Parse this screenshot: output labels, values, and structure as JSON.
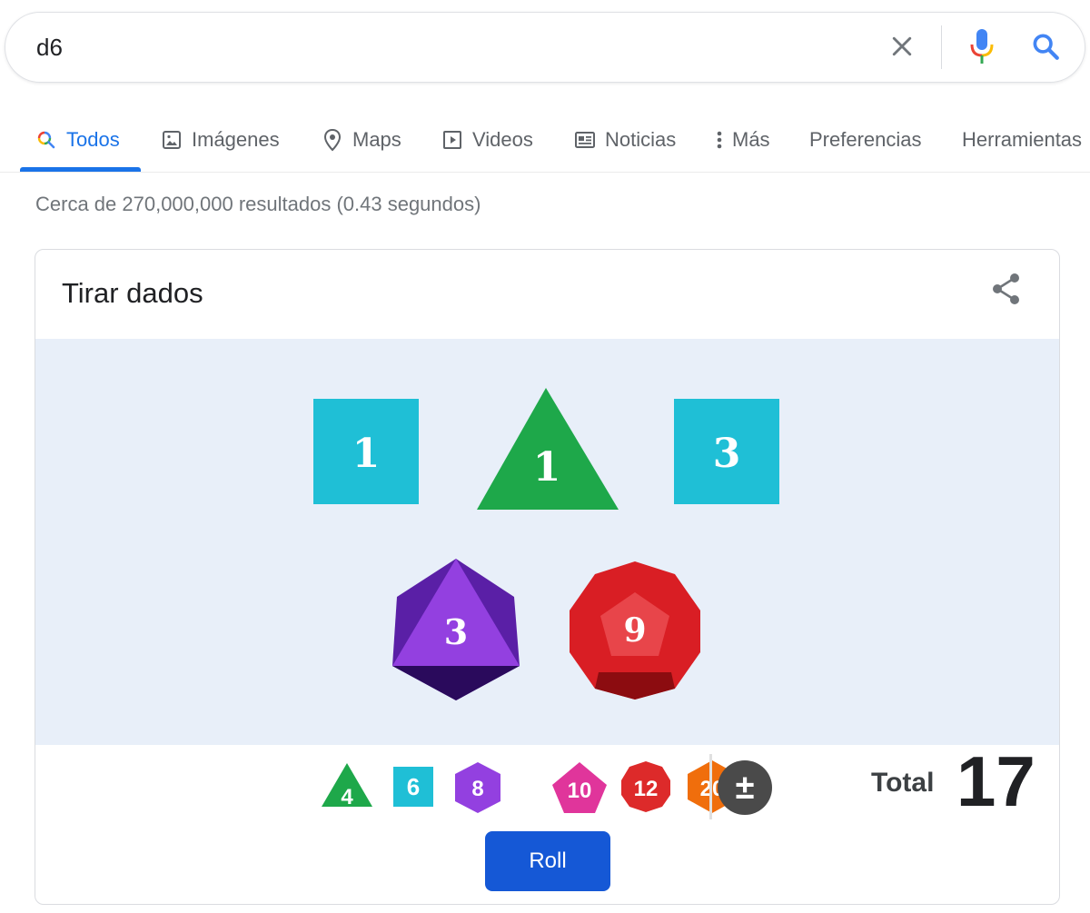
{
  "search": {
    "query": "d6"
  },
  "tabs": [
    {
      "label": "Todos",
      "icon": "search-multicolor-icon",
      "active": true
    },
    {
      "label": "Imágenes",
      "icon": "image-icon"
    },
    {
      "label": "Maps",
      "icon": "map-pin-icon"
    },
    {
      "label": "Videos",
      "icon": "play-icon"
    },
    {
      "label": "Noticias",
      "icon": "news-icon"
    },
    {
      "label": "Más",
      "icon": "more-vert-icon"
    },
    {
      "label": "Preferencias"
    },
    {
      "label": "Herramientas"
    }
  ],
  "result_stats": "Cerca de 270,000,000 resultados (0.43 segundos)",
  "card": {
    "title": "Tirar dados",
    "dice": [
      {
        "sides": 6,
        "value": "1",
        "color": "#1fbfd6"
      },
      {
        "sides": 4,
        "value": "1",
        "color": "#1ea84a"
      },
      {
        "sides": 6,
        "value": "3",
        "color": "#1fbfd6"
      },
      {
        "sides": 8,
        "value": "3",
        "color": "#9340e0"
      },
      {
        "sides": 12,
        "value": "9",
        "color": "#dd2a2a"
      }
    ],
    "total_label": "Total",
    "total_value": "17",
    "picker": [
      {
        "label": "4",
        "color": "#1ea84a"
      },
      {
        "label": "6",
        "color": "#1fbfd6"
      },
      {
        "label": "8",
        "color": "#9340e0"
      },
      {
        "label": "10",
        "color": "#e0359b"
      },
      {
        "label": "12",
        "color": "#dd2a2a"
      },
      {
        "label": "20",
        "color": "#f06e0c"
      },
      {
        "label": "±",
        "color": "#4a4a4a"
      }
    ],
    "roll_label": "Roll"
  }
}
